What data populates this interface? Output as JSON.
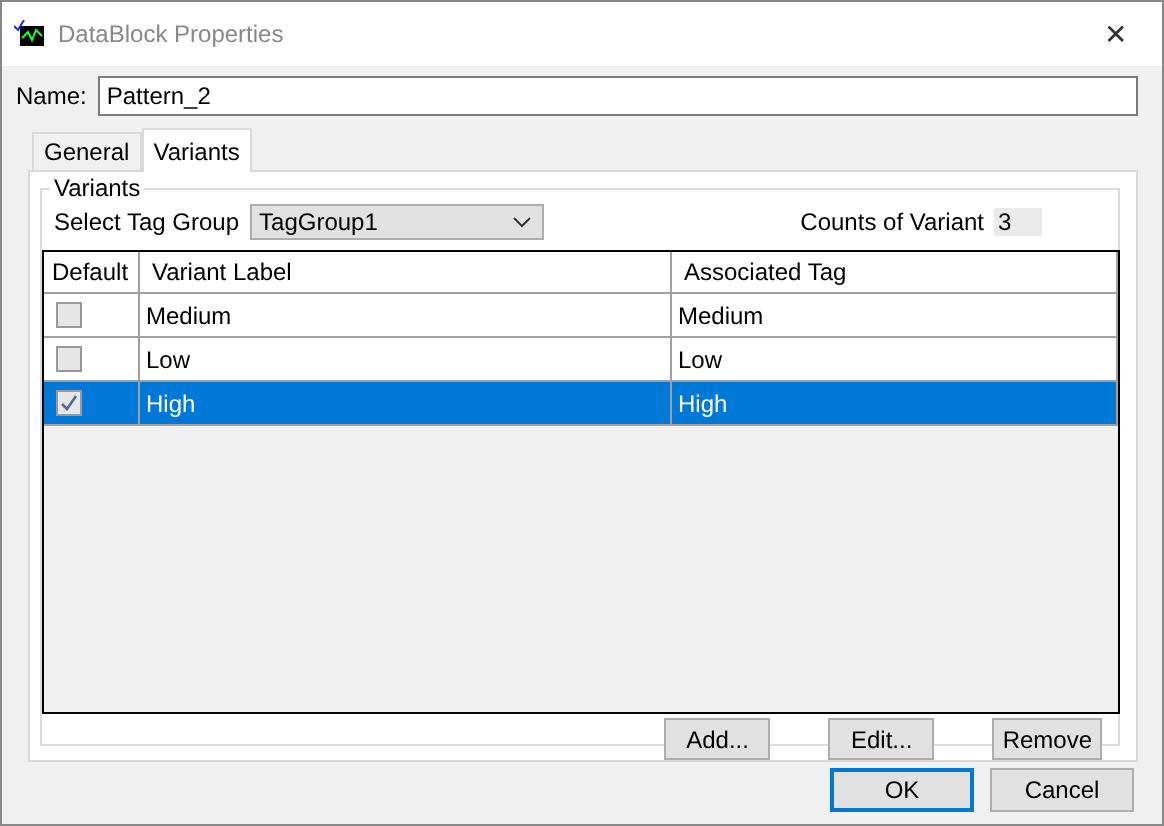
{
  "window": {
    "title": "DataBlock Properties",
    "close": "✕"
  },
  "name_field": {
    "label": "Name:",
    "value": "Pattern_2"
  },
  "tabs": [
    {
      "label": "General",
      "selected": false
    },
    {
      "label": "Variants",
      "selected": true
    }
  ],
  "group": {
    "title": "Variants",
    "tag_group_label": "Select Tag Group",
    "tag_group_value": "TagGroup1",
    "count_label": "Counts of Variant",
    "count_value": "3"
  },
  "table": {
    "columns": [
      "Default",
      "Variant Label",
      "Associated Tag"
    ],
    "rows": [
      {
        "checked": false,
        "label": "Medium",
        "tag": "Medium",
        "selected": false
      },
      {
        "checked": false,
        "label": "Low",
        "tag": "Low",
        "selected": false
      },
      {
        "checked": true,
        "label": "High",
        "tag": "High",
        "selected": true
      }
    ]
  },
  "row_buttons": [
    "Add...",
    "Edit...",
    "Remove"
  ],
  "dialog_buttons": [
    {
      "label": "OK",
      "default": true
    },
    {
      "label": "Cancel",
      "default": false
    }
  ]
}
